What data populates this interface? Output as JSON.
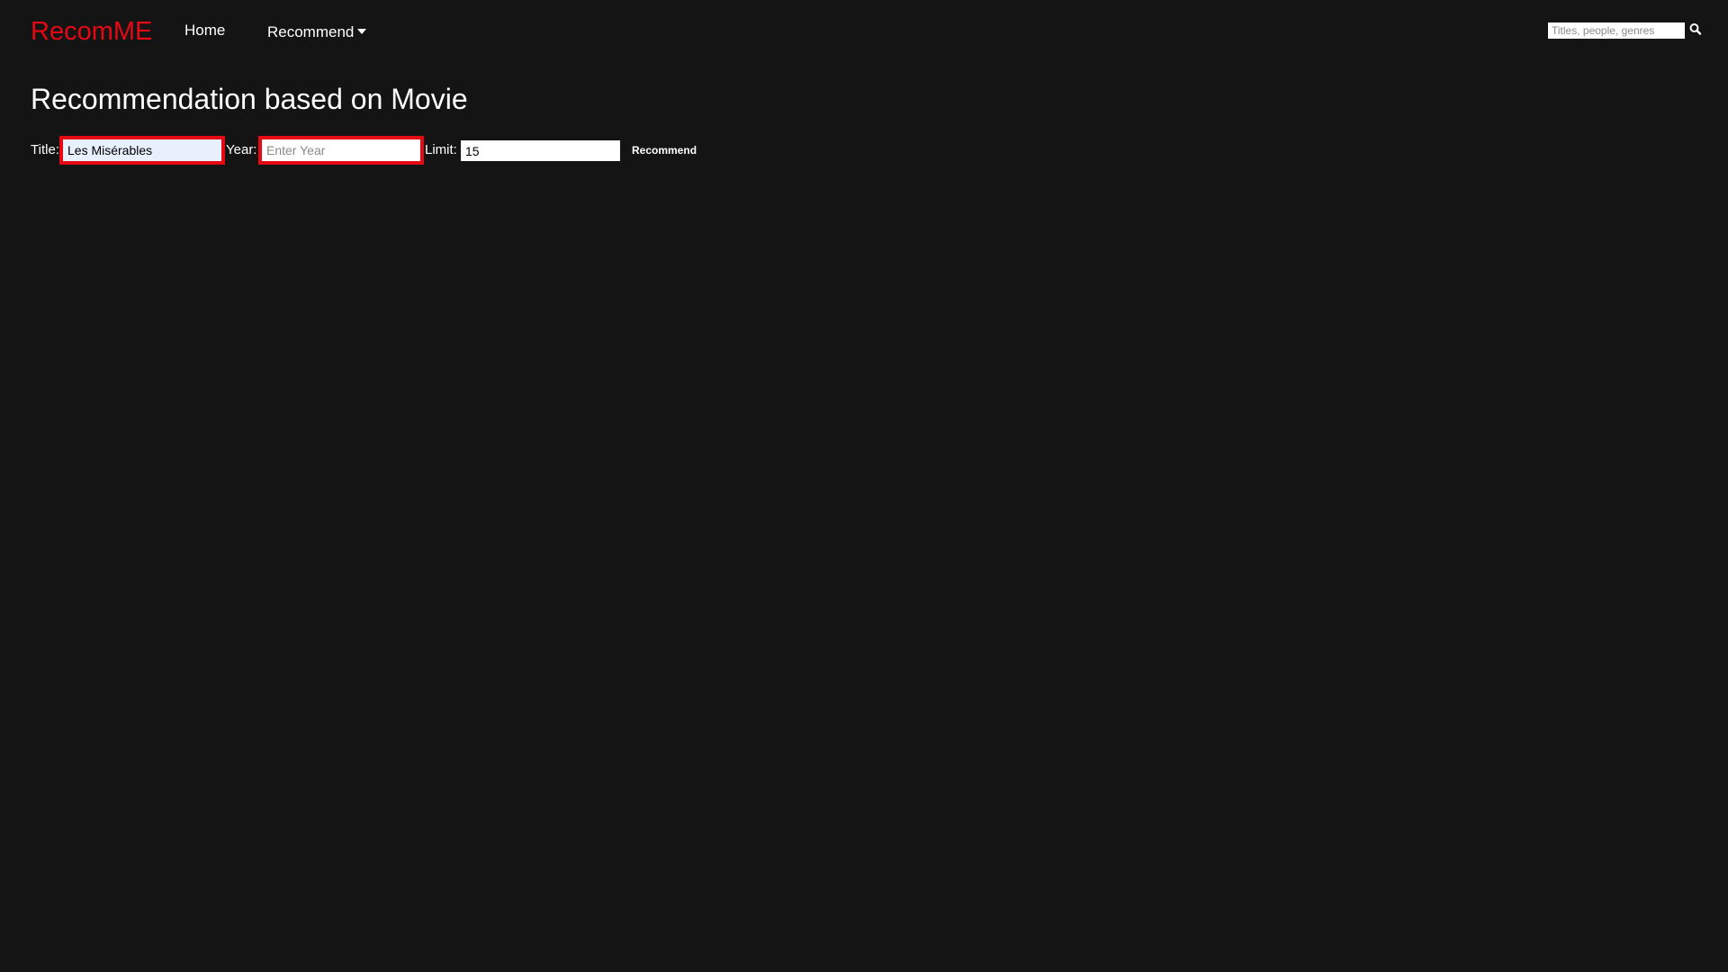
{
  "nav": {
    "brand": "RecomME",
    "home_label": "Home",
    "recommend_label": "Recommend",
    "search": {
      "placeholder": "Titles, people, genres",
      "value": ""
    }
  },
  "main": {
    "title": "Recommendation based on Movie",
    "form": {
      "title_label": "Title:",
      "title_value": "Les Misérables",
      "year_label": "Year:",
      "year_placeholder": "Enter Year",
      "year_value": "",
      "limit_label": "Limit:",
      "limit_value": "15",
      "submit_label": "Recommend"
    }
  },
  "colors": {
    "background": "#141414",
    "accent": "#e50914",
    "text": "#ffffff",
    "title_field_bg": "#e8f0fe"
  },
  "icons": {
    "search": "search-icon",
    "dropdown": "caret-down-icon"
  }
}
